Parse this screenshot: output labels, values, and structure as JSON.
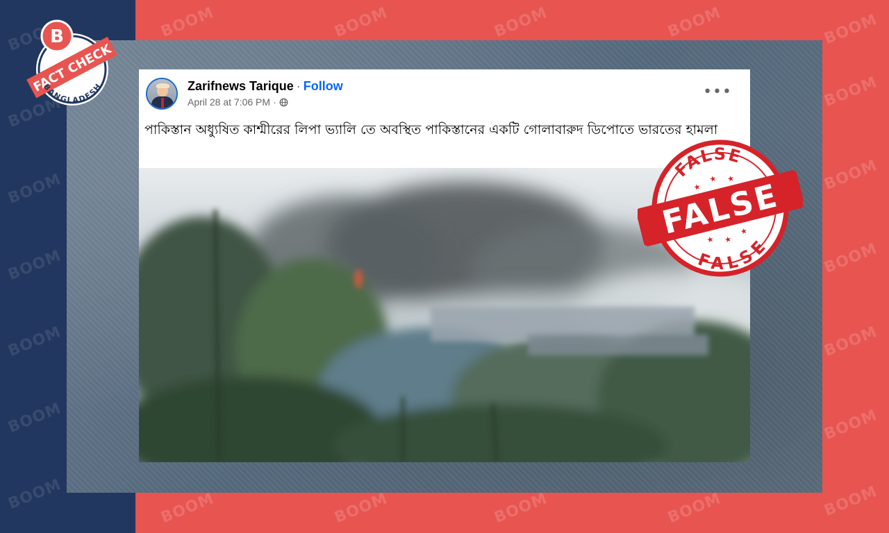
{
  "brand": {
    "watermark_text": "BOOM",
    "colors": {
      "red": "#e85450",
      "navy": "#22375f",
      "facebook_blue": "#0866ff"
    }
  },
  "logo": {
    "letter": "B",
    "ribbon_text": "FACT CHECK",
    "country": "BANGLADESH"
  },
  "post": {
    "author": "Zarifnews Tarique",
    "separator": "·",
    "follow_label": "Follow",
    "date": "April 28 at 7:06 PM",
    "privacy_icon": "globe-icon",
    "more_label": "•••",
    "caption": "পাকিস্তান অধ্যুষিত কাশ্মীরের লিপা ভ্যালি তে অবস্থিত পাকিস্তানের একটি গোলাবারুদ ডিপোতে ভারতের হামলা",
    "media_icon": "video-frame-smoke-forest"
  },
  "verdict": {
    "word": "FALSE",
    "color": "#d62229"
  }
}
